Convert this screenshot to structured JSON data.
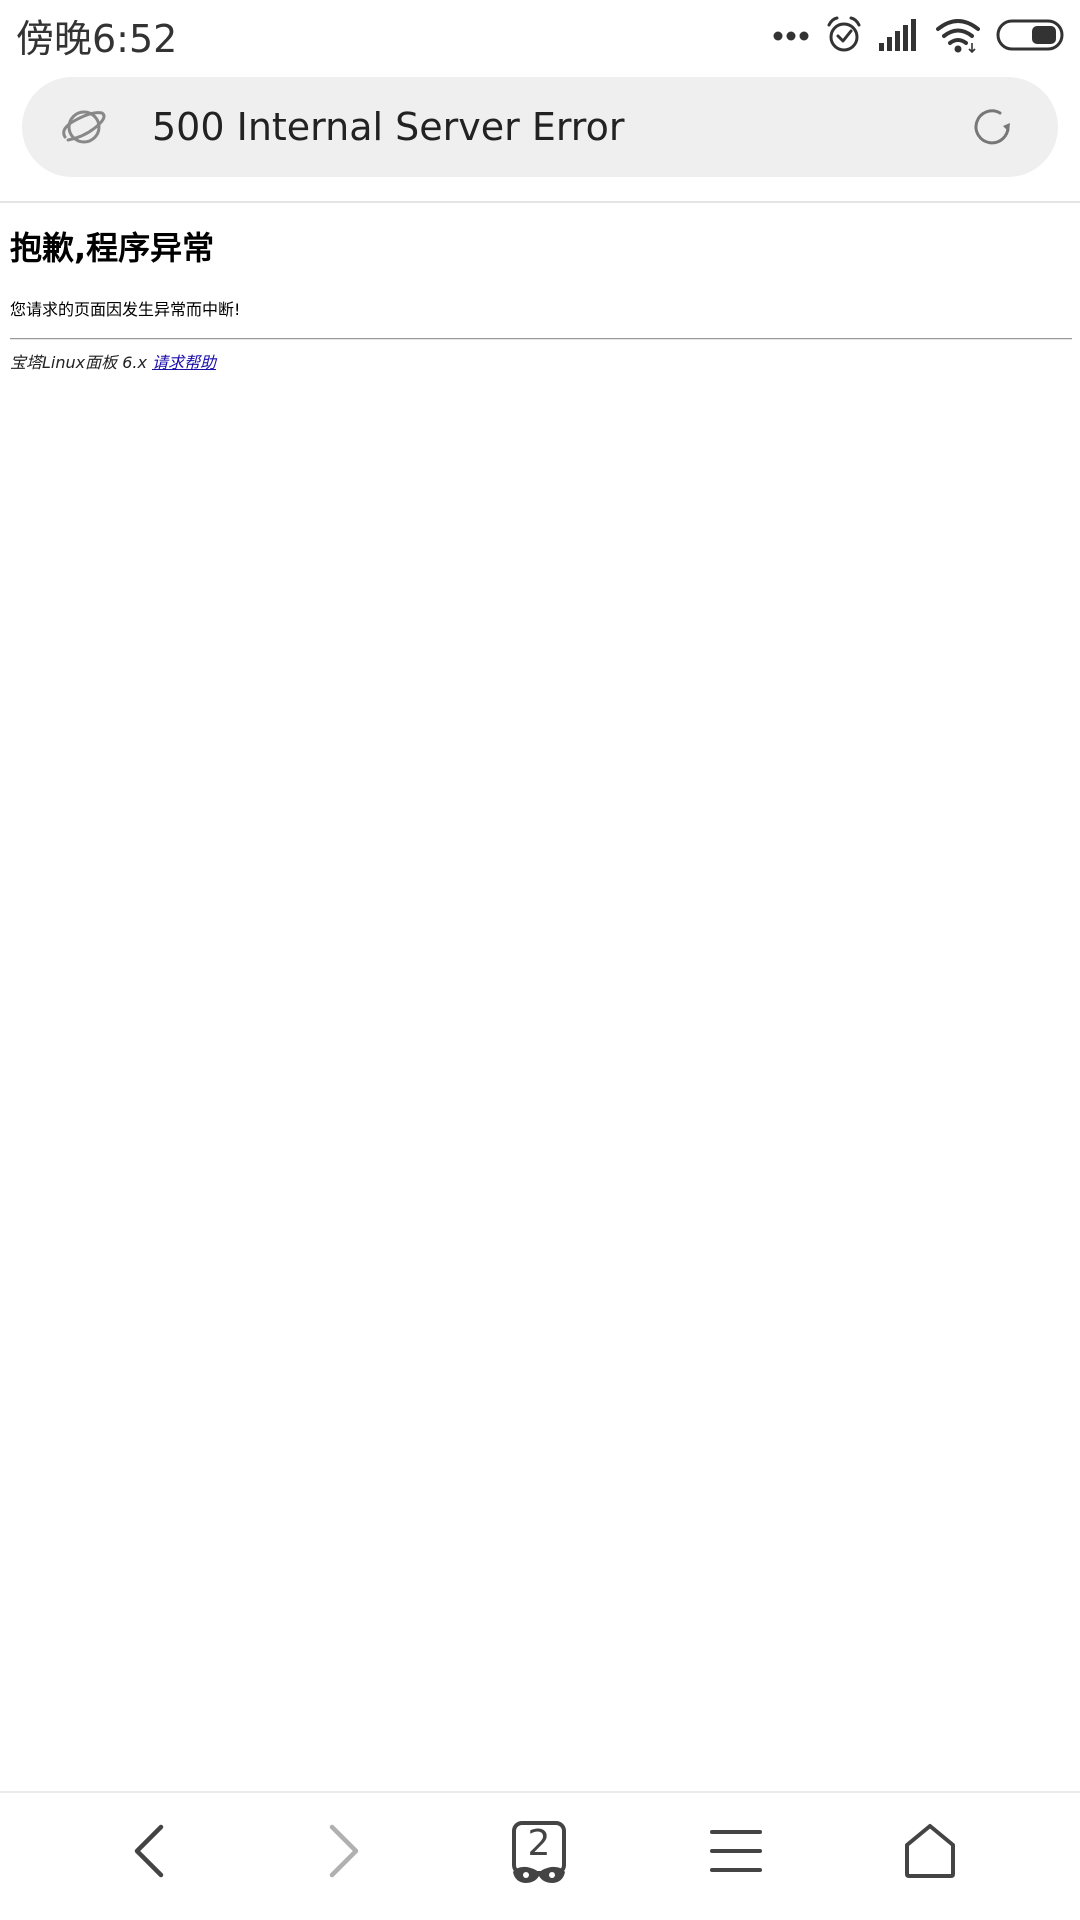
{
  "status_bar": {
    "time": "傍晚6:52",
    "icons": [
      "more-dots-icon",
      "alarm-icon",
      "signal-icon",
      "wifi-icon",
      "battery-icon"
    ]
  },
  "address_bar": {
    "page_title": "500 Internal Server Error",
    "site_icon": "planet-icon",
    "reload_icon": "reload-icon"
  },
  "page": {
    "heading": "抱歉,程序异常",
    "message": "您请求的页面因发生异常而中断!",
    "footer_text": "宝塔Linux面板 6.x ",
    "help_link": "请求帮助"
  },
  "bottom_nav": {
    "tab_count": "2",
    "items": [
      "back-icon",
      "forward-icon",
      "tabs-icon",
      "menu-icon",
      "home-icon"
    ]
  },
  "colors": {
    "address_bar_bg": "#efefef",
    "link": "#1a0dab",
    "icon": "#444444",
    "icon_disabled": "#b0b0b0"
  }
}
